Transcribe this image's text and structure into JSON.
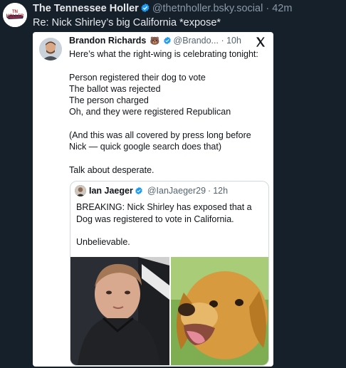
{
  "post": {
    "author_name": "The Tennessee Holler",
    "author_handle": "@thetnholler.bsky.social",
    "separator": "·",
    "time": "42m",
    "reply_text": "Re: Nick Shirley’s big California *expose*",
    "avatar_text": "TN HOLLER"
  },
  "tweet": {
    "author_name": "Brandon Richards",
    "emoji": "🐻",
    "author_handle": "@Brando...",
    "separator": "·",
    "time": "10h",
    "lines": [
      "Here’s what the right-wing is celebrating tonight:",
      "",
      "Person registered their dog to vote",
      "The ballot was rejected",
      "The person charged",
      "Oh, and they were registered Republican",
      "",
      "(And this was all covered by press long before",
      "Nick — quick google search does that)",
      "",
      "Talk about desperate."
    ]
  },
  "quote": {
    "author_name": "Ian Jaeger",
    "author_handle": "@IanJaeger29",
    "separator": "·",
    "time": "12h",
    "lines": [
      "BREAKING: Nick Shirley has exposed that a",
      "Dog was registered to vote in California.",
      "",
      "Unbelievable."
    ]
  },
  "icons": {
    "verified": "verified-badge-icon",
    "x_logo": "x-logo-icon"
  },
  "colors": {
    "background": "#15202b",
    "verified_blue": "#1d9bf0",
    "embed_bg": "#ffffff"
  }
}
